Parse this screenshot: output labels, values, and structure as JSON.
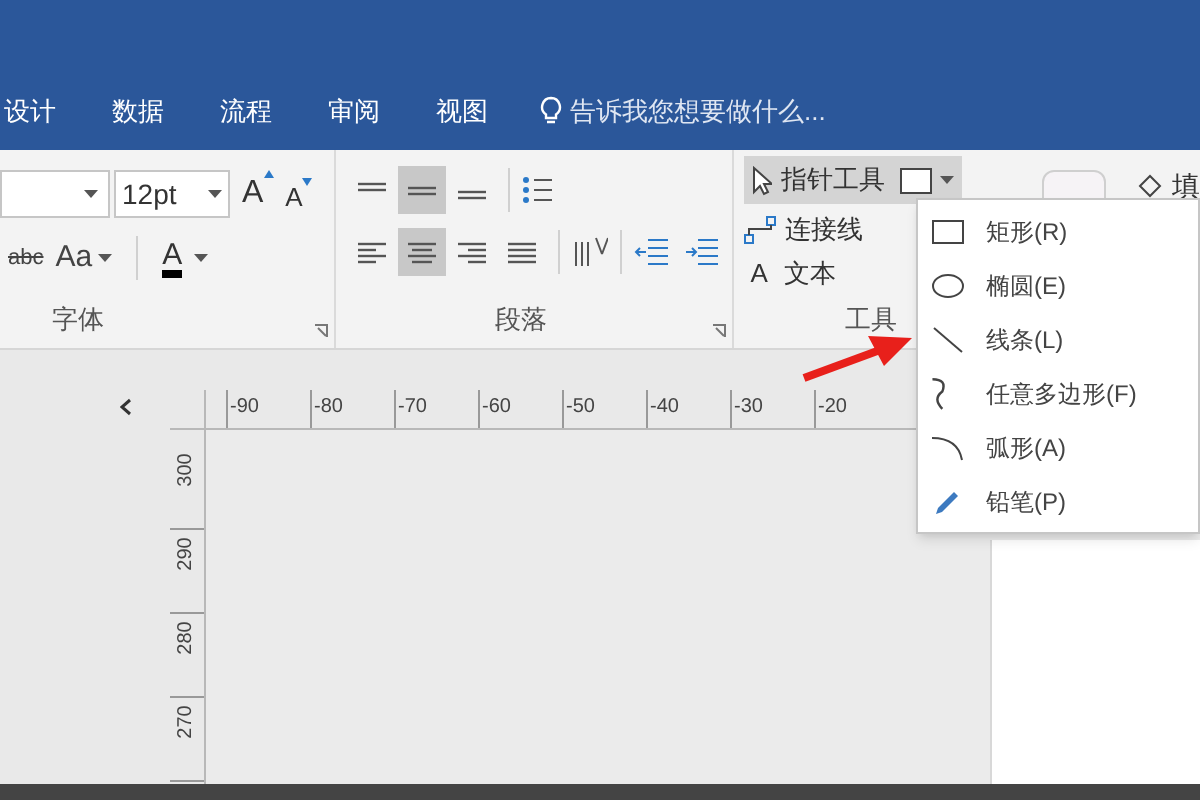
{
  "tabs": [
    {
      "label": "设计",
      "selected": false
    },
    {
      "label": "数据",
      "selected": false
    },
    {
      "label": "流程",
      "selected": false
    },
    {
      "label": "审阅",
      "selected": false
    },
    {
      "label": "视图",
      "selected": false
    }
  ],
  "tell_me": {
    "placeholder": "告诉我您想要做什么..."
  },
  "font_group": {
    "label": "字体",
    "font_size": "12pt",
    "case_button": "Aa",
    "strike_sample": "abc",
    "color_letter": "A",
    "grow_letter": "A",
    "shrink_letter": "A"
  },
  "paragraph_group": {
    "label": "段落",
    "row1": [
      {
        "kind": "top",
        "selected": false
      },
      {
        "kind": "middle",
        "selected": true
      },
      {
        "kind": "bottom",
        "selected": false
      }
    ],
    "row2": [
      {
        "kind": "left",
        "selected": false
      },
      {
        "kind": "center",
        "selected": true
      },
      {
        "kind": "right",
        "selected": false
      },
      {
        "kind": "justify",
        "selected": false
      }
    ]
  },
  "tools_group": {
    "label": "工具",
    "pointer": {
      "label": "指针工具",
      "selected": true
    },
    "connector": "连接线",
    "text_tool": {
      "icon_letter": "A",
      "label": "文本"
    }
  },
  "fill_label": "填",
  "shape_menu": [
    {
      "kind": "rect",
      "label": "矩形(R)"
    },
    {
      "kind": "ellipse",
      "label": "椭圆(E)"
    },
    {
      "kind": "line",
      "label": "线条(L)"
    },
    {
      "kind": "freeform",
      "label": "任意多边形(F)"
    },
    {
      "kind": "arc",
      "label": "弧形(A)"
    },
    {
      "kind": "pencil",
      "label": "铅笔(P)"
    }
  ],
  "ruler": {
    "horizontal": [
      "-90",
      "-80",
      "-70",
      "-60",
      "-50",
      "-40",
      "-30",
      "-20"
    ],
    "vertical": [
      "300",
      "290",
      "280",
      "270"
    ]
  }
}
